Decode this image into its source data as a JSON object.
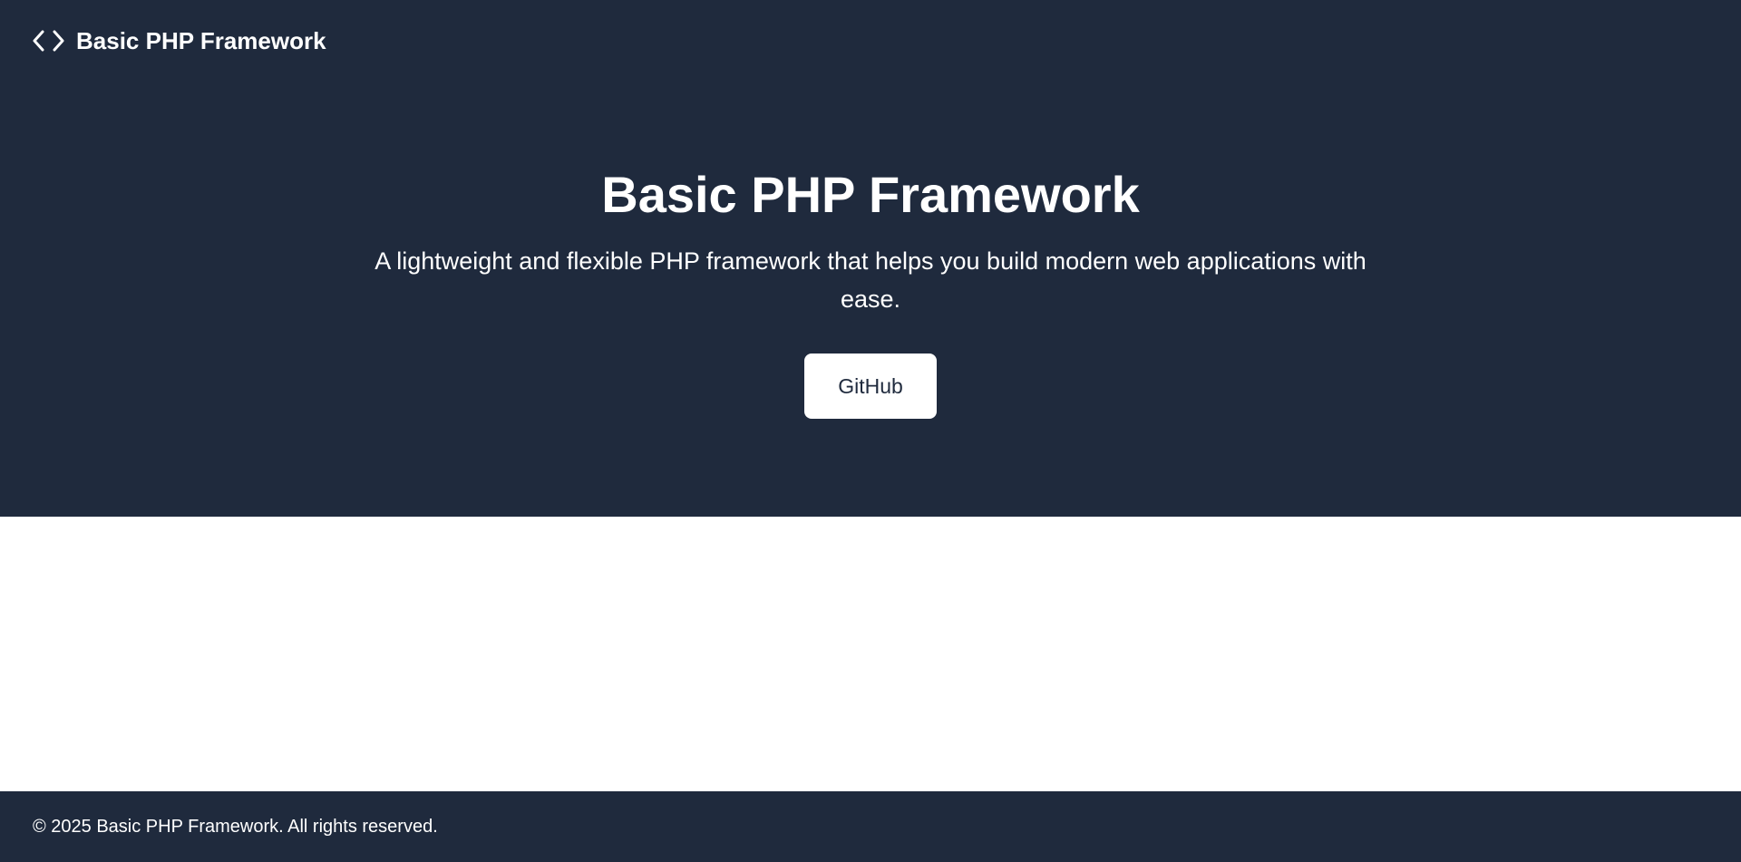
{
  "navbar": {
    "brand_name": "Basic PHP Framework",
    "brand_icon": "code-icon"
  },
  "hero": {
    "title": "Basic PHP Framework",
    "subtitle": "A lightweight and flexible PHP framework that helps you build modern web applications with ease.",
    "button_label": "GitHub"
  },
  "footer": {
    "text": "© 2025 Basic PHP Framework. All rights reserved."
  },
  "colors": {
    "primary_dark": "#1f2a3d",
    "text_light": "#ffffff",
    "background": "#ffffff"
  }
}
